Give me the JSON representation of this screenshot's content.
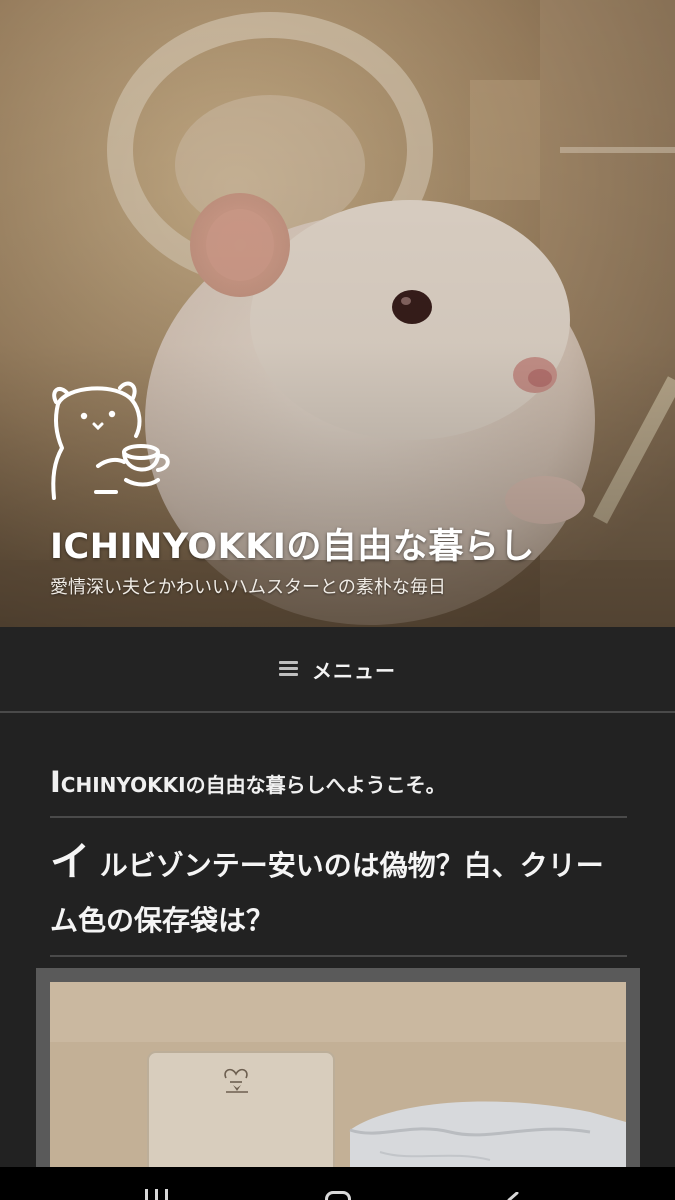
{
  "site": {
    "title": "ICHINYOKKIの自由な暮らし",
    "tagline": "愛情深い夫とかわいいハムスターとの素朴な毎日"
  },
  "menu": {
    "label": "メニュー",
    "icon": "hamburger-icon"
  },
  "welcome": {
    "dropcap": "I",
    "rest": "CHINYOKKIの自由な暮らしへようこそ。"
  },
  "post": {
    "dropcap": "イ",
    "rest": "ルビゾンテー安いのは偽物？白、クリーム色の保存袋は？"
  },
  "nav_bar": {
    "buttons": [
      "recents-icon",
      "home-icon",
      "back-icon"
    ]
  },
  "colors": {
    "background": "#222222",
    "divider": "#4a4a4a",
    "text": "#f2f2f2",
    "nav_bar": "#000000"
  }
}
